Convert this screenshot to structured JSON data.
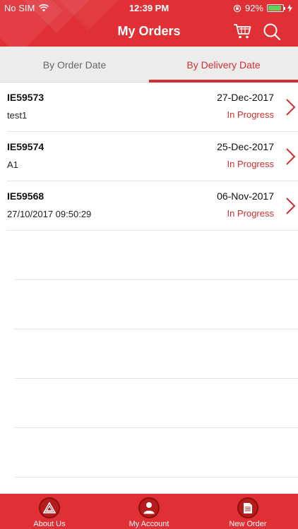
{
  "status_bar": {
    "carrier": "No SIM",
    "time": "12:39 PM",
    "battery_percent": "92%",
    "battery_level": 0.92
  },
  "header": {
    "title": "My Orders",
    "icons": [
      "cart-icon",
      "search-icon"
    ]
  },
  "tabs": [
    {
      "label": "By Order Date",
      "active": false
    },
    {
      "label": "By Delivery Date",
      "active": true
    }
  ],
  "orders": [
    {
      "id": "IE59573",
      "description": "test1",
      "date": "27-Dec-2017",
      "status": "In Progress"
    },
    {
      "id": "IE59574",
      "description": "A1",
      "date": "25-Dec-2017",
      "status": "In Progress"
    },
    {
      "id": "IE59568",
      "description": "27/10/2017 09:50:29",
      "date": "06-Nov-2017",
      "status": "In Progress"
    }
  ],
  "bottom_nav": [
    {
      "label": "About Us",
      "icon": "logo-icon"
    },
    {
      "label": "My Account",
      "icon": "user-icon"
    },
    {
      "label": "New Order",
      "icon": "document-icon"
    }
  ],
  "colors": {
    "brand_red": "#e03035",
    "accent_red": "#d32f2f",
    "tab_bg": "#ececec",
    "battery_green": "#5fd25a"
  }
}
